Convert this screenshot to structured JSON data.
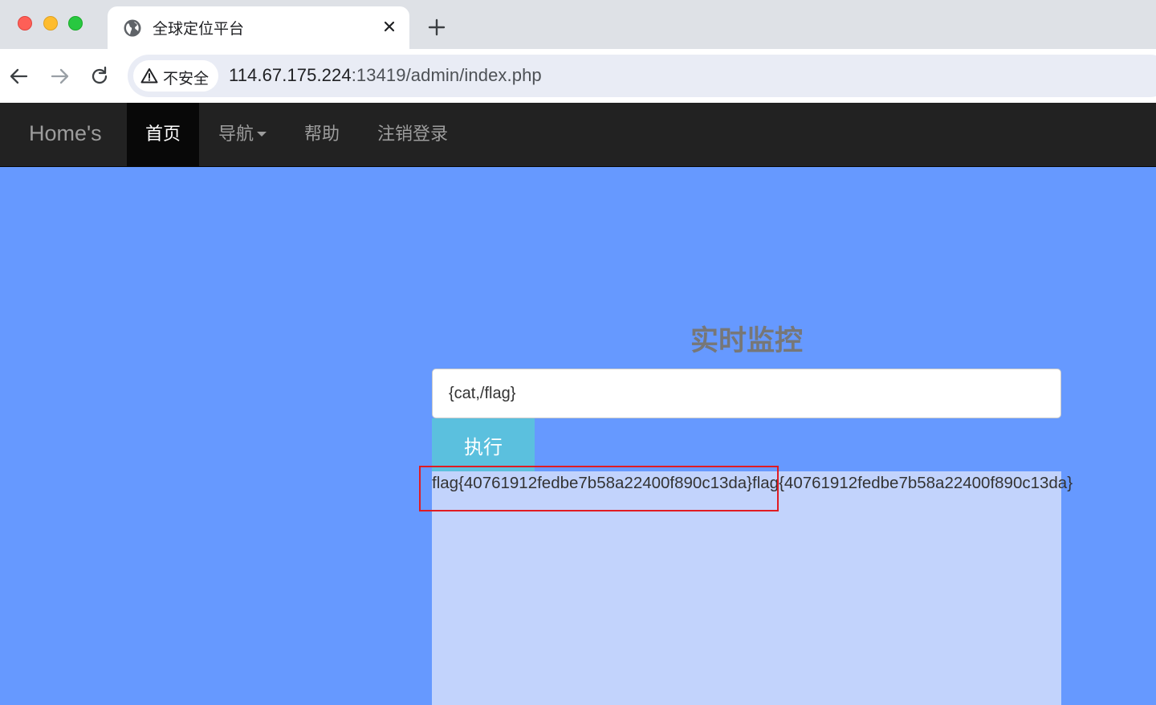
{
  "browser": {
    "tab_title": "全球定位平台",
    "security_label": "不安全",
    "url_host": "114.67.175.224",
    "url_path": ":13419/admin/index.php",
    "icons": {
      "tab": "globe-icon",
      "close": "close-icon",
      "new_tab": "plus-icon",
      "back": "arrow-left-icon",
      "forward": "arrow-right-icon",
      "reload": "reload-icon",
      "security": "warning-triangle-icon"
    }
  },
  "navbar": {
    "brand": "Home's",
    "items": [
      {
        "label": "首页",
        "active": true
      },
      {
        "label": "导航",
        "dropdown": true
      },
      {
        "label": "帮助"
      },
      {
        "label": "注销登录"
      }
    ]
  },
  "main": {
    "heading": "实时监控",
    "command_value": "{cat,/flag}",
    "execute_label": "执行",
    "output_first": "flag{40761912fedbe7b58a22400f890c13da}",
    "output_second": "flag{40761912fedbe7b58a22400f890c13da}"
  },
  "colors": {
    "page_bg": "#6699ff",
    "navbar_bg": "#222222",
    "button_bg": "#5bc0de",
    "output_bg": "#c2d3fc",
    "highlight": "#e01b22"
  }
}
